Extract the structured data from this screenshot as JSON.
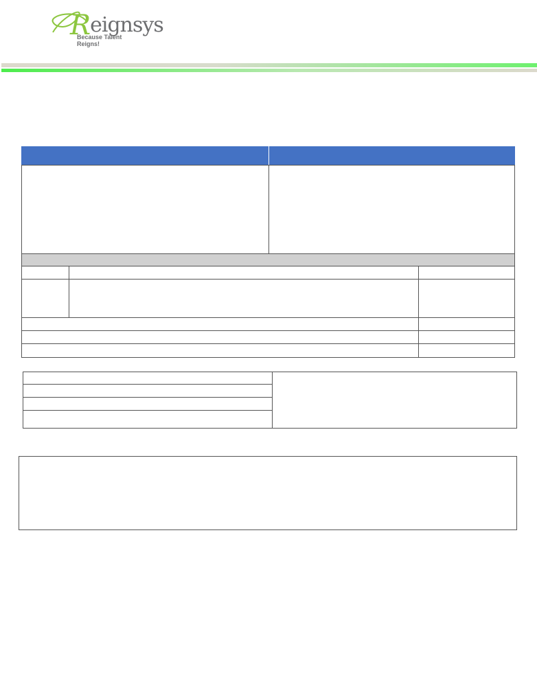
{
  "logo": {
    "brand": "Reignsys",
    "initial": "R",
    "rest": "eignsys",
    "tagline": "Because Talent Reigns!"
  },
  "colors": {
    "header_blue": "#4472C4",
    "section_gray": "#D0D0D0",
    "accent_green": "#4CEB4C"
  }
}
